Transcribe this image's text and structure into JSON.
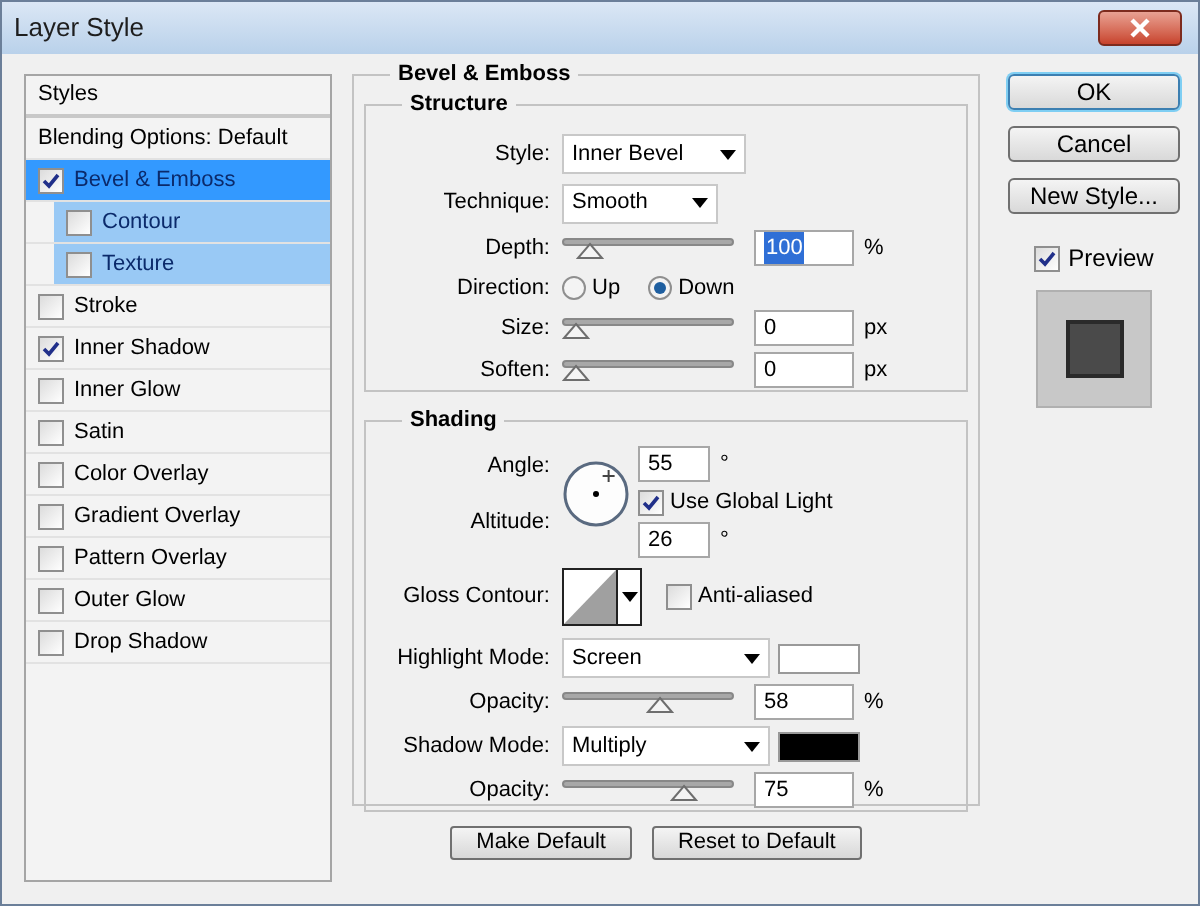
{
  "window": {
    "title": "Layer Style"
  },
  "styles_list": {
    "header": "Styles",
    "items": [
      {
        "label": "Blending Options: Default",
        "kind": "plain",
        "selected": false
      },
      {
        "label": "Bevel & Emboss",
        "kind": "check",
        "checked": true,
        "selected": true,
        "children": [
          {
            "label": "Contour",
            "checked": false
          },
          {
            "label": "Texture",
            "checked": false
          }
        ]
      },
      {
        "label": "Stroke",
        "kind": "check",
        "checked": false,
        "selected": false
      },
      {
        "label": "Inner Shadow",
        "kind": "check",
        "checked": true,
        "selected": false
      },
      {
        "label": "Inner Glow",
        "kind": "check",
        "checked": false,
        "selected": false
      },
      {
        "label": "Satin",
        "kind": "check",
        "checked": false,
        "selected": false
      },
      {
        "label": "Color Overlay",
        "kind": "check",
        "checked": false,
        "selected": false
      },
      {
        "label": "Gradient Overlay",
        "kind": "check",
        "checked": false,
        "selected": false
      },
      {
        "label": "Pattern Overlay",
        "kind": "check",
        "checked": false,
        "selected": false
      },
      {
        "label": "Outer Glow",
        "kind": "check",
        "checked": false,
        "selected": false
      },
      {
        "label": "Drop Shadow",
        "kind": "check",
        "checked": false,
        "selected": false
      }
    ]
  },
  "panel": {
    "title": "Bevel & Emboss",
    "structure": {
      "title": "Structure",
      "style": {
        "label": "Style:",
        "value": "Inner Bevel"
      },
      "technique": {
        "label": "Technique:",
        "value": "Smooth"
      },
      "depth": {
        "label": "Depth:",
        "value": "100",
        "unit": "%",
        "level": 0.1,
        "highlighted": true
      },
      "direction": {
        "label": "Direction:",
        "options": [
          {
            "label": "Up",
            "selected": false
          },
          {
            "label": "Down",
            "selected": true
          }
        ]
      },
      "size": {
        "label": "Size:",
        "value": "0",
        "unit": "px",
        "level": 0
      },
      "soften": {
        "label": "Soften:",
        "value": "0",
        "unit": "px",
        "level": 0
      }
    },
    "shading": {
      "title": "Shading",
      "angle": {
        "label": "Angle:",
        "value": "55",
        "unit": "°"
      },
      "use_global_light": {
        "label": "Use Global Light",
        "checked": true
      },
      "altitude": {
        "label": "Altitude:",
        "value": "26",
        "unit": "°"
      },
      "gloss_contour": {
        "label": "Gloss Contour:"
      },
      "anti_aliased": {
        "label": "Anti-aliased",
        "checked": false
      },
      "highlight_mode": {
        "label": "Highlight Mode:",
        "value": "Screen",
        "color": "#ffffff"
      },
      "highlight_opacity": {
        "label": "Opacity:",
        "value": "58",
        "unit": "%",
        "level": 0.58
      },
      "shadow_mode": {
        "label": "Shadow Mode:",
        "value": "Multiply",
        "color": "#000000"
      },
      "shadow_opacity": {
        "label": "Opacity:",
        "value": "75",
        "unit": "%",
        "level": 0.75
      }
    },
    "buttons": [
      "Make Default",
      "Reset to Default"
    ]
  },
  "actions": [
    {
      "label": "OK",
      "default": true
    },
    {
      "label": "Cancel",
      "default": false
    },
    {
      "label": "New Style...",
      "default": false
    }
  ],
  "preview": {
    "label": "Preview",
    "checked": true
  }
}
